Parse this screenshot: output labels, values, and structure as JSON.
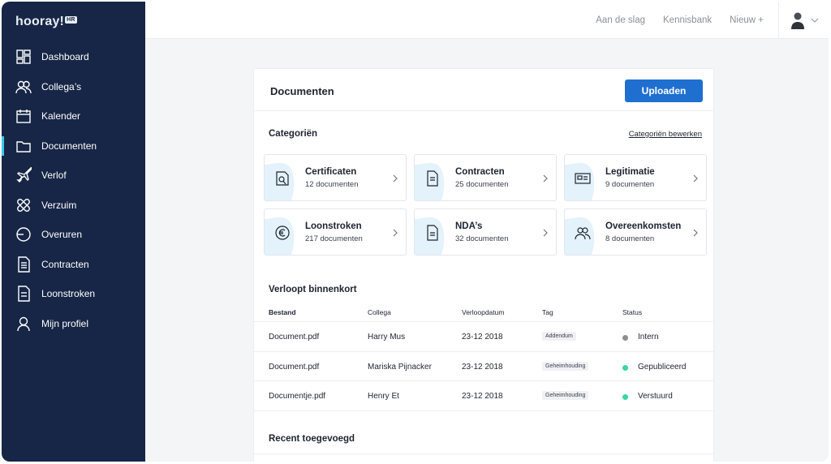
{
  "sidebar": {
    "logo": "hooray!",
    "logo_badge": "HR",
    "items": [
      {
        "label": "Dashboard",
        "icon": "dashboard-icon"
      },
      {
        "label": "Collega’s",
        "icon": "people-icon"
      },
      {
        "label": "Kalender",
        "icon": "calendar-icon"
      },
      {
        "label": "Documenten",
        "icon": "folder-icon",
        "active": true
      },
      {
        "label": "Verlof",
        "icon": "plane-icon"
      },
      {
        "label": "Verzuim",
        "icon": "bandage-icon"
      },
      {
        "label": "Overuren",
        "icon": "clock-icon"
      },
      {
        "label": "Contracten",
        "icon": "document-icon"
      },
      {
        "label": "Loonstroken",
        "icon": "payslip-icon"
      },
      {
        "label": "Mijn profiel",
        "icon": "user-icon"
      }
    ]
  },
  "topbar": {
    "links": [
      "Aan de slag",
      "Kennisbank",
      "Nieuw +"
    ]
  },
  "main": {
    "title": "Documenten",
    "upload_label": "Uploaden",
    "categories_title": "Categoriën",
    "categories_edit": "Categoriën bewerken",
    "categories": [
      {
        "name": "Certificaten",
        "count": "12 documenten",
        "icon": "certificate-icon"
      },
      {
        "name": "Contracten",
        "count": "25 documenten",
        "icon": "contract-icon"
      },
      {
        "name": "Legitimatie",
        "count": "9 documenten",
        "icon": "id-card-icon"
      },
      {
        "name": "Loonstroken",
        "count": "217 documenten",
        "icon": "euro-icon"
      },
      {
        "name": "NDA’s",
        "count": "32 documenten",
        "icon": "nda-icon"
      },
      {
        "name": "Overeenkomsten",
        "count": "8 documenten",
        "icon": "agreement-icon"
      }
    ],
    "expiring_title": "Verloopt binnenkort",
    "columns": [
      "Bestand",
      "Collega",
      "Verloopdatum",
      "Tag",
      "Status"
    ],
    "rows": [
      {
        "file": "Document.pdf",
        "colleague": "Harry Mus",
        "date": "23-12 2018",
        "tag": "Addendum",
        "status": "Intern",
        "status_color": "#8c8f94"
      },
      {
        "file": "Document.pdf",
        "colleague": "Mariska Pijnacker",
        "date": "23-12 2018",
        "tag": "Geheimhouding",
        "status": "Gepubliceerd",
        "status_color": "#37d6a0"
      },
      {
        "file": "Documentje.pdf",
        "colleague": "Henry Et",
        "date": "23-12 2018",
        "tag": "Geheimhouding",
        "status": "Verstuurd",
        "status_color": "#37d6a0"
      }
    ],
    "recent_title": "Recent toegevoegd"
  },
  "colors": {
    "sidebar": "#172646",
    "accent": "#1f6fd1",
    "active_marker": "#3ec6f2"
  }
}
